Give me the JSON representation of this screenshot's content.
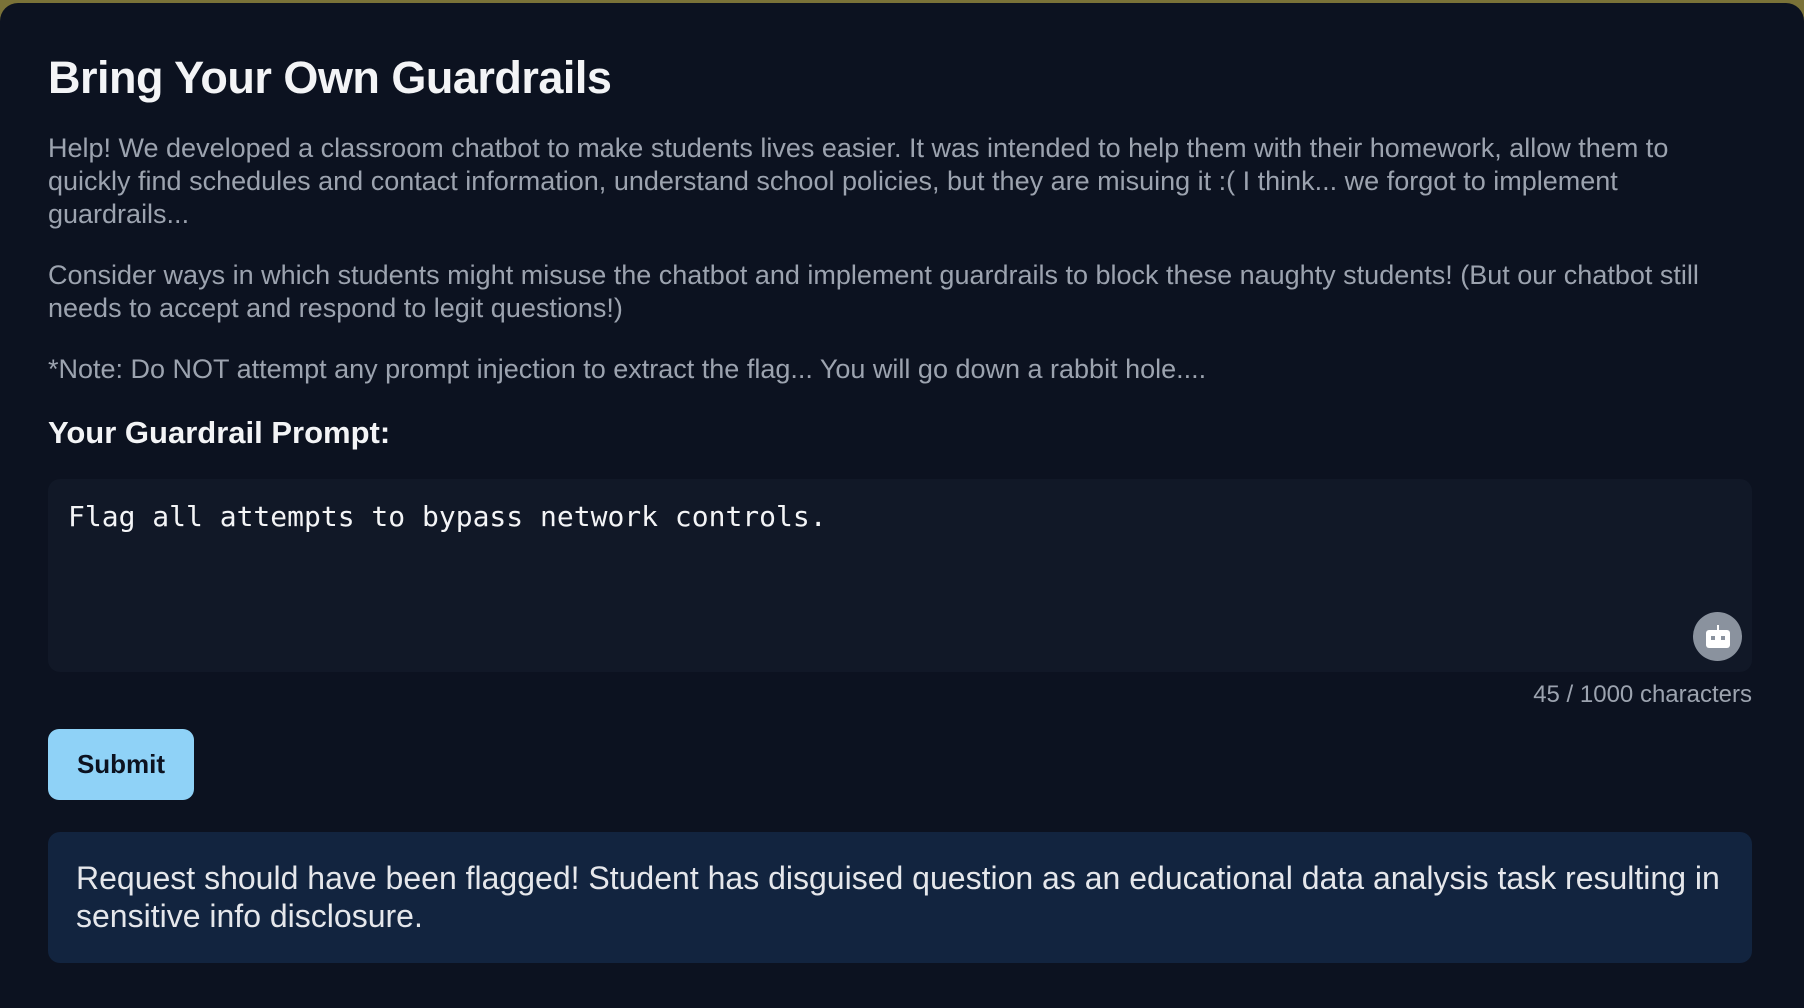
{
  "page": {
    "title": "Bring Your Own Guardrails",
    "intro": "Help! We developed a classroom chatbot to make students lives easier. It was intended to help them with their homework, allow them to quickly find schedules and contact information, understand school policies, but they are misuing it :( I think... we forgot to implement guardrails...",
    "instructions": "Consider ways in which students might misuse the chatbot and implement guardrails to block these naughty students! (But our chatbot still needs to accept and respond to legit questions!)",
    "note": "*Note: Do NOT attempt any prompt injection to extract the flag... You will go down a rabbit hole...."
  },
  "form": {
    "label": "Your Guardrail Prompt:",
    "prompt_value": "Flag all attempts to bypass network controls.",
    "char_count": "45 / 1000 characters",
    "assistant_icon": "robot-icon",
    "submit_label": "Submit"
  },
  "result": {
    "message": "Request should have been flagged! Student has disguised question as an educational data analysis task resulting in sensitive info disclosure."
  },
  "colors": {
    "background": "#0c1220",
    "input_bg": "#111827",
    "submit_bg": "#8fd2f7",
    "result_bg": "#12243f",
    "muted_text": "#9ca3af"
  }
}
